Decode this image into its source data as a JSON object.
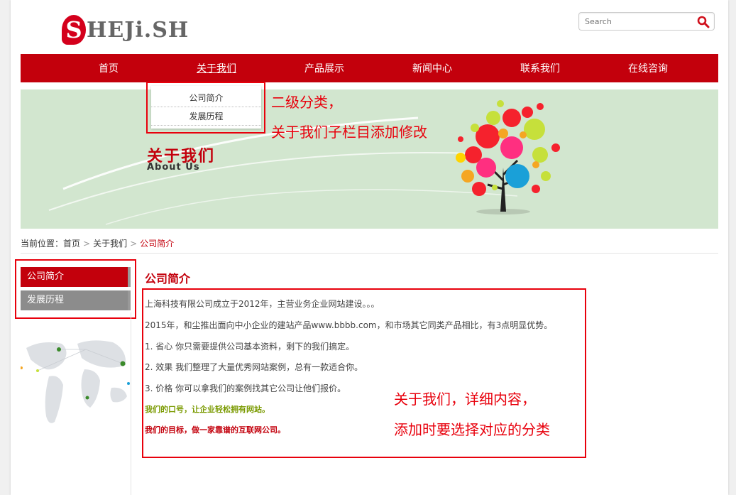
{
  "header": {
    "logo_letter": "S",
    "logo_text": "HEJi.SH",
    "search_placeholder": "Search"
  },
  "nav": [
    {
      "label": "首页"
    },
    {
      "label": "关于我们"
    },
    {
      "label": "产品展示"
    },
    {
      "label": "新闻中心"
    },
    {
      "label": "联系我们"
    },
    {
      "label": "在线咨询"
    }
  ],
  "dropdown": [
    "公司简介",
    "发展历程"
  ],
  "banner": {
    "title": "关于我们",
    "subtitle": "About Us"
  },
  "annotations": {
    "submenu_line1": "二级分类，",
    "submenu_line2": "关于我们子栏目添加修改",
    "content_line1": "关于我们，详细内容，",
    "content_line2": "添加时要选择对应的分类"
  },
  "breadcrumb": {
    "prefix": "当前位置：",
    "home": "首页",
    "sep": ">",
    "parent": "关于我们",
    "current": "公司简介"
  },
  "sidebar": [
    "公司简介",
    "发展历程"
  ],
  "content": {
    "title": "公司简介",
    "p1": "上海科技有限公司成立于2012年，主营业务企业网站建设。。。",
    "p2": "2015年，和尘推出面向中小企业的建站产品www.bbbb.com，和市场其它同类产品相比，有3点明显优势。",
    "p3": "1. 省心 你只需要提供公司基本资料，剩下的我们搞定。",
    "p4": "2. 效果 我们整理了大量优秀网站案例，总有一款适合你。",
    "p5": "3. 价格 你可以拿我们的案例找其它公司让他们报价。",
    "slogan": "我们的口号，让企业轻松拥有网站。",
    "goal": "我们的目标，做一家靠谱的互联网公司。"
  },
  "colors": {
    "brand_red": "#c3000c",
    "annotation_red": "#e8000c",
    "banner_bg": "#d2e6cf",
    "slogan_green": "#7a9a00"
  }
}
